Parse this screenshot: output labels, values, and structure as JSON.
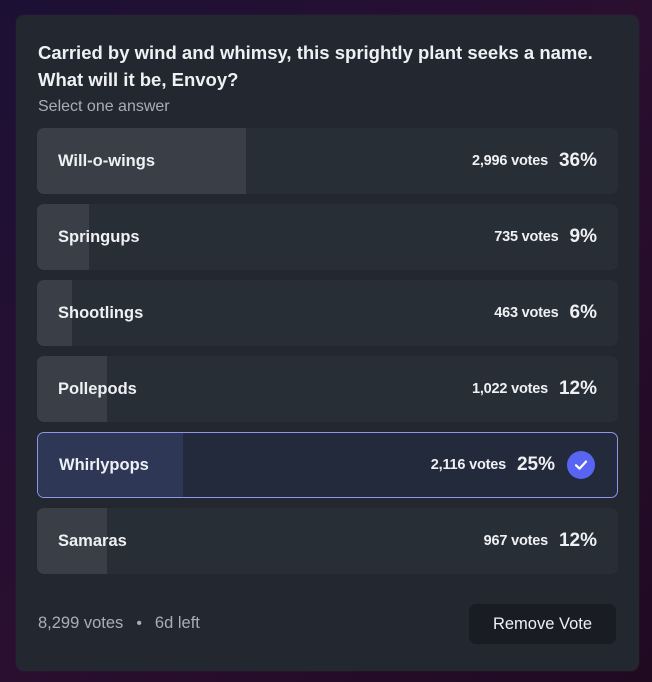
{
  "poll": {
    "question": "Carried by wind and whimsy, this sprightly plant seeks a name. What will it be, Envoy?",
    "instruction": "Select one answer",
    "options": [
      {
        "label": "Will-o-wings",
        "votes": "2,996 votes",
        "percent": "36%",
        "fraction": 0.36
      },
      {
        "label": "Springups",
        "votes": "735 votes",
        "percent": "9%",
        "fraction": 0.09
      },
      {
        "label": "Shootlings",
        "votes": "463 votes",
        "percent": "6%",
        "fraction": 0.06
      },
      {
        "label": "Pollepods",
        "votes": "1,022 votes",
        "percent": "12%",
        "fraction": 0.12
      },
      {
        "label": "Whirlypops",
        "votes": "2,116 votes",
        "percent": "25%",
        "fraction": 0.25,
        "selected": true
      },
      {
        "label": "Samaras",
        "votes": "967 votes",
        "percent": "12%",
        "fraction": 0.12
      }
    ],
    "total_votes": "8,299 votes",
    "separator": "•",
    "time_left": "6d left",
    "remove_vote_label": "Remove Vote"
  },
  "colors": {
    "accent": "#5865f2",
    "selected_border": "#8d96e8"
  },
  "icons": {
    "selected_marker": "checkmark-icon"
  }
}
